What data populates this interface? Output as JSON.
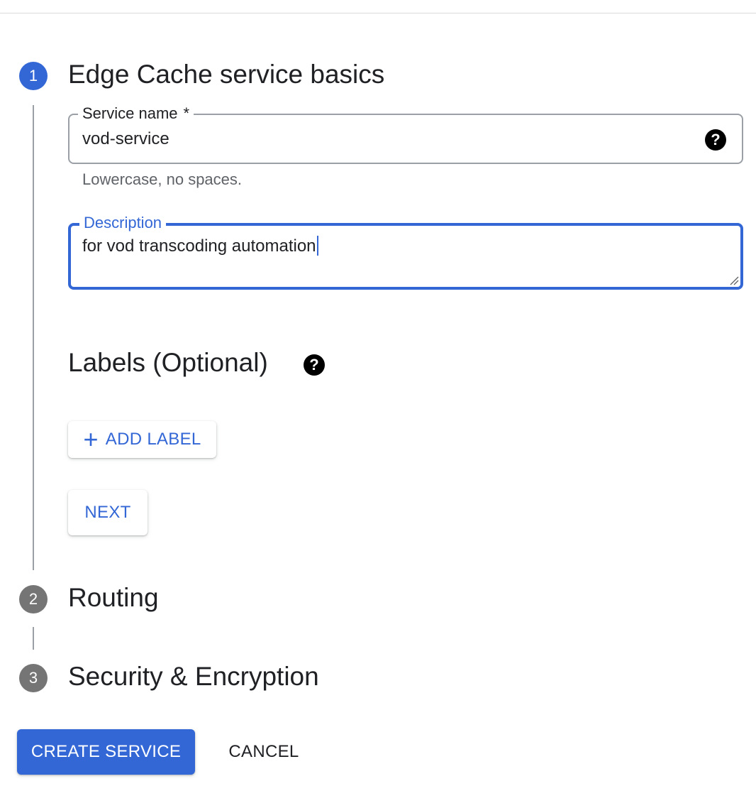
{
  "steps": [
    {
      "number": "1",
      "title": "Edge Cache service basics",
      "state": "active"
    },
    {
      "number": "2",
      "title": "Routing",
      "state": "inactive"
    },
    {
      "number": "3",
      "title": "Security & Encryption",
      "state": "inactive"
    }
  ],
  "service_name": {
    "label": "Service name",
    "required_marker": "*",
    "value": "vod-service",
    "hint": "Lowercase, no spaces.",
    "help_icon": "help-circle-icon"
  },
  "description": {
    "label": "Description",
    "value": "for vod transcoding automation"
  },
  "labels_section": {
    "title": "Labels (Optional)",
    "help_icon": "help-circle-icon",
    "add_button_label": "ADD LABEL",
    "add_button_icon": "plus-icon"
  },
  "next_button_label": "NEXT",
  "footer": {
    "create_label": "CREATE SERVICE",
    "cancel_label": "CANCEL"
  },
  "colors": {
    "accent": "#3367d6",
    "inactive_step": "#757575",
    "text": "#202124",
    "hint": "#5f6368",
    "outline": "#9aa0a6"
  }
}
